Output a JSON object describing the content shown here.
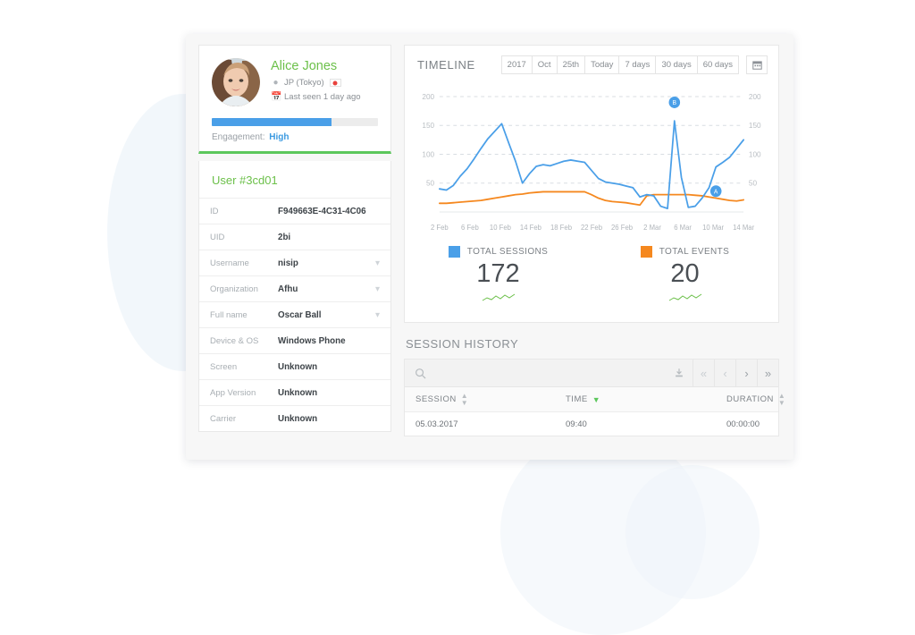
{
  "profile": {
    "name": "Alice Jones",
    "location": "JP (Tokyo)",
    "last_seen": "Last seen 1 day ago",
    "location_icon": "map-pin-icon",
    "calendar_icon": "calendar-icon",
    "engagement_label": "Engagement:",
    "engagement_value": "High",
    "engagement_percent": 72
  },
  "details": {
    "title": "User #3cd01",
    "rows": [
      {
        "label": "ID",
        "value": "F949663E-4C31-4C06",
        "editable": false
      },
      {
        "label": "UID",
        "value": "2bi",
        "editable": false
      },
      {
        "label": "Username",
        "value": "nisip",
        "editable": true
      },
      {
        "label": "Organization",
        "value": "Afhu",
        "editable": true
      },
      {
        "label": "Full name",
        "value": "Oscar Ball",
        "editable": true
      },
      {
        "label": "Device & OS",
        "value": "Windows Phone",
        "editable": false
      },
      {
        "label": "Screen",
        "value": "Unknown",
        "editable": false
      },
      {
        "label": "App Version",
        "value": "Unknown",
        "editable": false
      },
      {
        "label": "Carrier",
        "value": "Unknown",
        "editable": false
      }
    ]
  },
  "timeline": {
    "title": "TIMELINE",
    "filters": [
      "2017",
      "Oct",
      "25th",
      "Today",
      "7 days",
      "30 days",
      "60 days"
    ],
    "calendar_icon": "calendar-icon"
  },
  "chart_data": {
    "type": "line",
    "title": "TIMELINE",
    "xlabel": "",
    "ylabel": "",
    "ylim": [
      0,
      200
    ],
    "yticks": [
      50,
      100,
      150,
      200
    ],
    "grid": true,
    "dual_axis": true,
    "tick_labels": [
      "2 Feb",
      "6 Feb",
      "10 Feb",
      "14 Feb",
      "18 Feb",
      "22 Feb",
      "26 Feb",
      "2 Mar",
      "6 Mar",
      "10 Mar",
      "14 Mar"
    ],
    "x": [
      1,
      2,
      3,
      4,
      5,
      6,
      7,
      8,
      9,
      10,
      11,
      12,
      13,
      14,
      15,
      16,
      17,
      18,
      19,
      20,
      21,
      22,
      23,
      24,
      25,
      26,
      27,
      28,
      29,
      30,
      31,
      32,
      33,
      34,
      35,
      36,
      37,
      38,
      39,
      40,
      41,
      42
    ],
    "series": [
      {
        "name": "TOTAL SESSIONS",
        "color": "#4a9fe8",
        "values": [
          40,
          38,
          46,
          62,
          75,
          92,
          110,
          127,
          140,
          153,
          120,
          88,
          50,
          66,
          79,
          82,
          80,
          84,
          88,
          90,
          88,
          86,
          72,
          58,
          52,
          50,
          48,
          45,
          42,
          26,
          30,
          28,
          10,
          6,
          158,
          60,
          8,
          10,
          24,
          42,
          78,
          86,
          95,
          110,
          125
        ]
      },
      {
        "name": "TOTAL EVENTS",
        "color": "#f5881f",
        "values": [
          15,
          15,
          16,
          17,
          18,
          19,
          20,
          22,
          24,
          26,
          28,
          30,
          31,
          33,
          34,
          35,
          35,
          35,
          35,
          35,
          35,
          35,
          30,
          24,
          20,
          18,
          17,
          16,
          14,
          12,
          28,
          30,
          30,
          30,
          30,
          30,
          30,
          29,
          28,
          26,
          24,
          22,
          20,
          19,
          21
        ]
      }
    ],
    "annotations": [
      {
        "label": "B",
        "x_value": 34,
        "y_value": 190,
        "color": "#4a9fe8"
      },
      {
        "label": "A",
        "x_value": 40,
        "y_value": 36,
        "color": "#4a9fe8"
      }
    ]
  },
  "stats": [
    {
      "label": "TOTAL SESSIONS",
      "value": "172",
      "color": "#4a9fe8"
    },
    {
      "label": "TOTAL EVENTS",
      "value": "20",
      "color": "#f5881f"
    }
  ],
  "session_history": {
    "title": "SESSION HISTORY",
    "search_placeholder": "",
    "search_icon": "search-icon",
    "download_icon": "download-icon",
    "pagination": [
      "first-page",
      "prev-page",
      "next-page",
      "last-page"
    ],
    "columns": [
      "SESSION",
      "TIME",
      "DURATION"
    ],
    "rows": [
      {
        "session": "05.03.2017",
        "time": "09:40",
        "duration": "00:00:00"
      }
    ]
  }
}
